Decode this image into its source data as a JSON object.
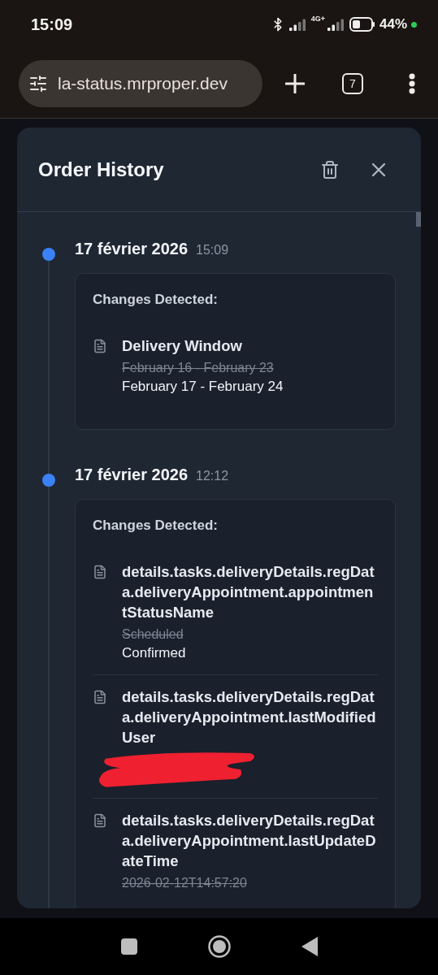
{
  "status_bar": {
    "time": "15:09",
    "network": "4G+",
    "battery": "44%"
  },
  "browser": {
    "url": "la-status.mrproper.dev",
    "tab_count": "7"
  },
  "modal": {
    "title": "Order History",
    "entries": [
      {
        "date": "17 février 2026",
        "time": "15:09",
        "heading": "Changes Detected:",
        "changes": [
          {
            "field": "Delivery Window",
            "old": "February 16 - February 23",
            "new": "February 17 - February 24",
            "redacted": false
          }
        ]
      },
      {
        "date": "17 février 2026",
        "time": "12:12",
        "heading": "Changes Detected:",
        "changes": [
          {
            "field": "details.tasks.deliveryDetails.regData.deliveryAppointment.appointmentStatusName",
            "old": "Scheduled",
            "new": "Confirmed",
            "redacted": false
          },
          {
            "field": "details.tasks.deliveryDetails.regData.deliveryAppointment.lastModifiedUser",
            "redacted": true
          },
          {
            "field": "details.tasks.deliveryDetails.regData.deliveryAppointment.lastUpdateDateTime",
            "old": "2026-02-12T14:57:20",
            "redacted": false
          }
        ]
      }
    ]
  }
}
